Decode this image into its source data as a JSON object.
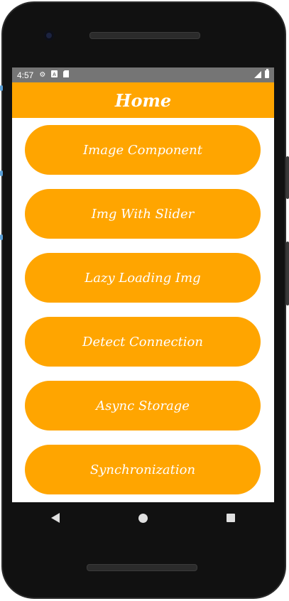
{
  "status_bar": {
    "time": "4:57",
    "icons": [
      "settings-icon",
      "sim-a-icon",
      "sd-card-icon"
    ],
    "right_icons": [
      "signal-icon",
      "battery-icon"
    ]
  },
  "header": {
    "title": "Home",
    "color": "#ffa500"
  },
  "menu": {
    "buttons": [
      {
        "label": "Image Component"
      },
      {
        "label": "Img With Slider"
      },
      {
        "label": "Lazy Loading Img"
      },
      {
        "label": "Detect Connection"
      },
      {
        "label": "Async Storage"
      },
      {
        "label": "Synchronization"
      }
    ]
  },
  "nav_bar": {
    "icons": [
      "back-icon",
      "home-icon",
      "recent-apps-icon"
    ]
  }
}
